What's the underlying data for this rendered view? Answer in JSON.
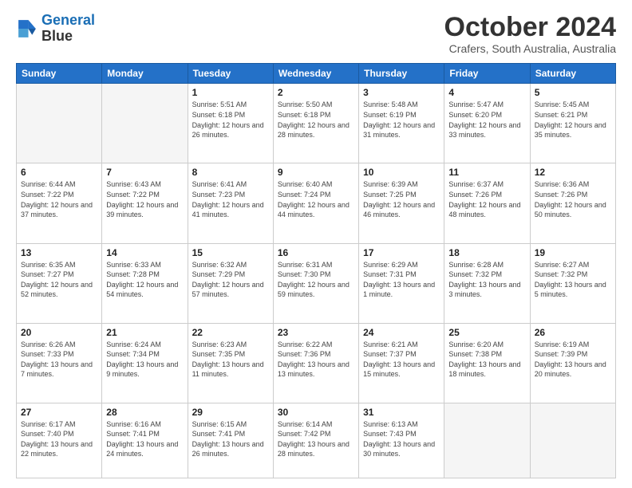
{
  "logo": {
    "line1": "General",
    "line2": "Blue"
  },
  "header": {
    "month": "October 2024",
    "location": "Crafers, South Australia, Australia"
  },
  "weekdays": [
    "Sunday",
    "Monday",
    "Tuesday",
    "Wednesday",
    "Thursday",
    "Friday",
    "Saturday"
  ],
  "weeks": [
    [
      {
        "day": "",
        "info": ""
      },
      {
        "day": "",
        "info": ""
      },
      {
        "day": "1",
        "info": "Sunrise: 5:51 AM\nSunset: 6:18 PM\nDaylight: 12 hours\nand 26 minutes."
      },
      {
        "day": "2",
        "info": "Sunrise: 5:50 AM\nSunset: 6:18 PM\nDaylight: 12 hours\nand 28 minutes."
      },
      {
        "day": "3",
        "info": "Sunrise: 5:48 AM\nSunset: 6:19 PM\nDaylight: 12 hours\nand 31 minutes."
      },
      {
        "day": "4",
        "info": "Sunrise: 5:47 AM\nSunset: 6:20 PM\nDaylight: 12 hours\nand 33 minutes."
      },
      {
        "day": "5",
        "info": "Sunrise: 5:45 AM\nSunset: 6:21 PM\nDaylight: 12 hours\nand 35 minutes."
      }
    ],
    [
      {
        "day": "6",
        "info": "Sunrise: 6:44 AM\nSunset: 7:22 PM\nDaylight: 12 hours\nand 37 minutes."
      },
      {
        "day": "7",
        "info": "Sunrise: 6:43 AM\nSunset: 7:22 PM\nDaylight: 12 hours\nand 39 minutes."
      },
      {
        "day": "8",
        "info": "Sunrise: 6:41 AM\nSunset: 7:23 PM\nDaylight: 12 hours\nand 41 minutes."
      },
      {
        "day": "9",
        "info": "Sunrise: 6:40 AM\nSunset: 7:24 PM\nDaylight: 12 hours\nand 44 minutes."
      },
      {
        "day": "10",
        "info": "Sunrise: 6:39 AM\nSunset: 7:25 PM\nDaylight: 12 hours\nand 46 minutes."
      },
      {
        "day": "11",
        "info": "Sunrise: 6:37 AM\nSunset: 7:26 PM\nDaylight: 12 hours\nand 48 minutes."
      },
      {
        "day": "12",
        "info": "Sunrise: 6:36 AM\nSunset: 7:26 PM\nDaylight: 12 hours\nand 50 minutes."
      }
    ],
    [
      {
        "day": "13",
        "info": "Sunrise: 6:35 AM\nSunset: 7:27 PM\nDaylight: 12 hours\nand 52 minutes."
      },
      {
        "day": "14",
        "info": "Sunrise: 6:33 AM\nSunset: 7:28 PM\nDaylight: 12 hours\nand 54 minutes."
      },
      {
        "day": "15",
        "info": "Sunrise: 6:32 AM\nSunset: 7:29 PM\nDaylight: 12 hours\nand 57 minutes."
      },
      {
        "day": "16",
        "info": "Sunrise: 6:31 AM\nSunset: 7:30 PM\nDaylight: 12 hours\nand 59 minutes."
      },
      {
        "day": "17",
        "info": "Sunrise: 6:29 AM\nSunset: 7:31 PM\nDaylight: 13 hours\nand 1 minute."
      },
      {
        "day": "18",
        "info": "Sunrise: 6:28 AM\nSunset: 7:32 PM\nDaylight: 13 hours\nand 3 minutes."
      },
      {
        "day": "19",
        "info": "Sunrise: 6:27 AM\nSunset: 7:32 PM\nDaylight: 13 hours\nand 5 minutes."
      }
    ],
    [
      {
        "day": "20",
        "info": "Sunrise: 6:26 AM\nSunset: 7:33 PM\nDaylight: 13 hours\nand 7 minutes."
      },
      {
        "day": "21",
        "info": "Sunrise: 6:24 AM\nSunset: 7:34 PM\nDaylight: 13 hours\nand 9 minutes."
      },
      {
        "day": "22",
        "info": "Sunrise: 6:23 AM\nSunset: 7:35 PM\nDaylight: 13 hours\nand 11 minutes."
      },
      {
        "day": "23",
        "info": "Sunrise: 6:22 AM\nSunset: 7:36 PM\nDaylight: 13 hours\nand 13 minutes."
      },
      {
        "day": "24",
        "info": "Sunrise: 6:21 AM\nSunset: 7:37 PM\nDaylight: 13 hours\nand 15 minutes."
      },
      {
        "day": "25",
        "info": "Sunrise: 6:20 AM\nSunset: 7:38 PM\nDaylight: 13 hours\nand 18 minutes."
      },
      {
        "day": "26",
        "info": "Sunrise: 6:19 AM\nSunset: 7:39 PM\nDaylight: 13 hours\nand 20 minutes."
      }
    ],
    [
      {
        "day": "27",
        "info": "Sunrise: 6:17 AM\nSunset: 7:40 PM\nDaylight: 13 hours\nand 22 minutes."
      },
      {
        "day": "28",
        "info": "Sunrise: 6:16 AM\nSunset: 7:41 PM\nDaylight: 13 hours\nand 24 minutes."
      },
      {
        "day": "29",
        "info": "Sunrise: 6:15 AM\nSunset: 7:41 PM\nDaylight: 13 hours\nand 26 minutes."
      },
      {
        "day": "30",
        "info": "Sunrise: 6:14 AM\nSunset: 7:42 PM\nDaylight: 13 hours\nand 28 minutes."
      },
      {
        "day": "31",
        "info": "Sunrise: 6:13 AM\nSunset: 7:43 PM\nDaylight: 13 hours\nand 30 minutes."
      },
      {
        "day": "",
        "info": ""
      },
      {
        "day": "",
        "info": ""
      }
    ]
  ]
}
